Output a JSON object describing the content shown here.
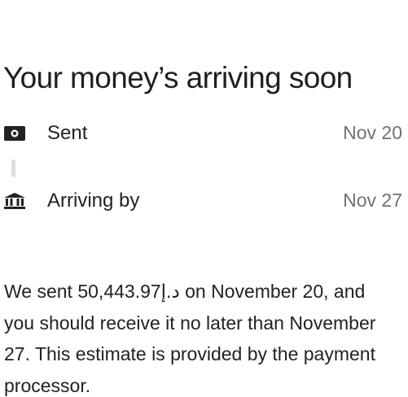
{
  "header": {
    "title": "Your money’s arriving soon"
  },
  "timeline": {
    "sent": {
      "icon": "cash-icon",
      "label": "Sent",
      "date": "Nov 20"
    },
    "arriving": {
      "icon": "bank-icon",
      "label": "Arriving by",
      "date": "Nov 27"
    }
  },
  "description": {
    "before_amount": "We sent ",
    "amount": "50,443.97د.إ",
    "after_amount": " on November 20, and you should receive it no later than November 27. This estimate is provided by the payment processor."
  },
  "colors": {
    "text": "#222222",
    "muted": "#717171",
    "connector": "#dddddd"
  }
}
